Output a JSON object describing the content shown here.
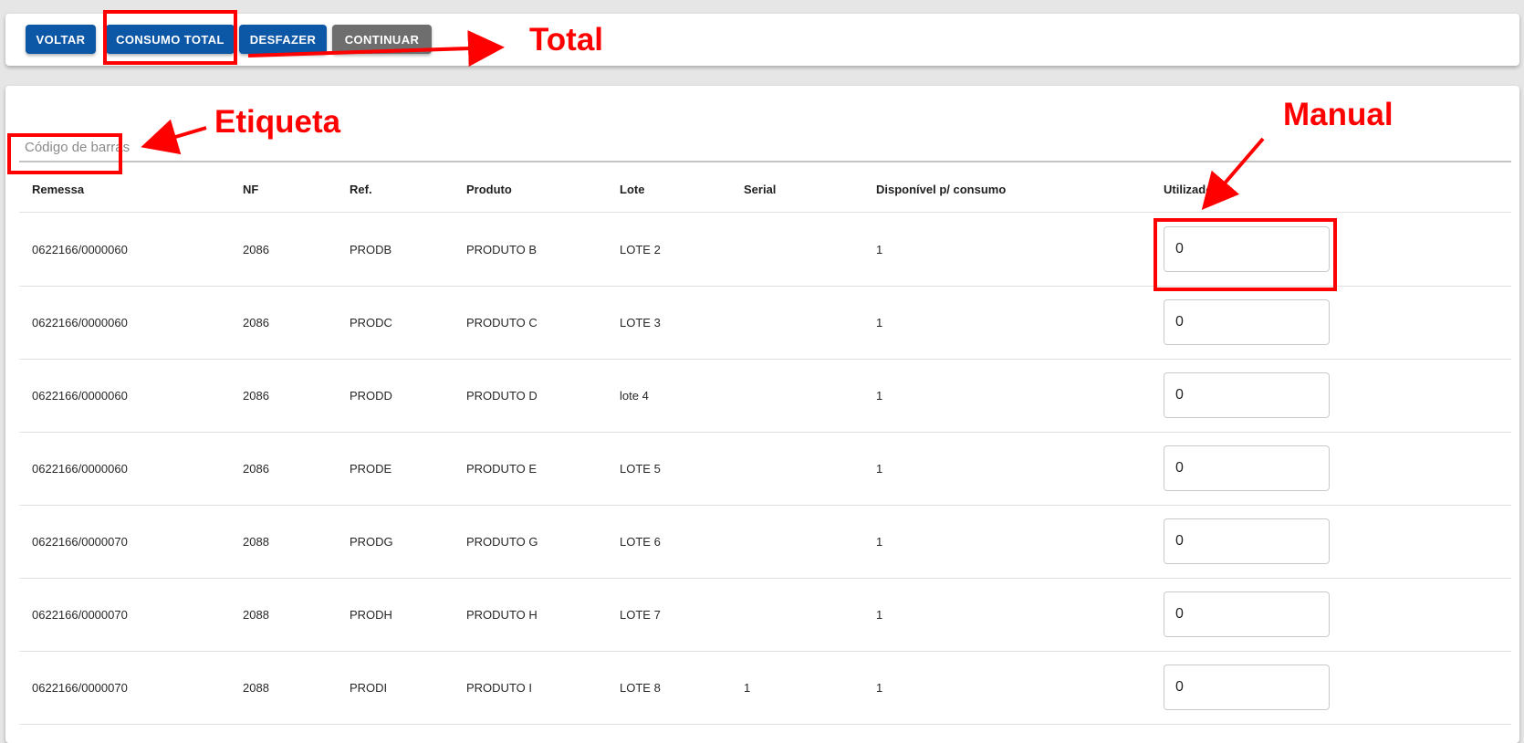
{
  "toolbar": {
    "voltar_label": "VOLTAR",
    "consumo_total_label": "CONSUMO TOTAL",
    "desfazer_label": "DESFAZER",
    "continuar_label": "CONTINUAR"
  },
  "barcode": {
    "placeholder": "Código de barras",
    "value": ""
  },
  "table": {
    "headers": {
      "remessa": "Remessa",
      "nf": "NF",
      "ref": "Ref.",
      "produto": "Produto",
      "lote": "Lote",
      "serial": "Serial",
      "disponivel": "Disponível p/ consumo",
      "utilizado": "Utilizado"
    },
    "rows": [
      {
        "remessa": "0622166/0000060",
        "nf": "2086",
        "ref": "PRODB",
        "produto": "PRODUTO B",
        "lote": "LOTE 2",
        "serial": "",
        "disponivel": "1",
        "utilizado": "0"
      },
      {
        "remessa": "0622166/0000060",
        "nf": "2086",
        "ref": "PRODC",
        "produto": "PRODUTO C",
        "lote": "LOTE 3",
        "serial": "",
        "disponivel": "1",
        "utilizado": "0"
      },
      {
        "remessa": "0622166/0000060",
        "nf": "2086",
        "ref": "PRODD",
        "produto": "PRODUTO D",
        "lote": "lote 4",
        "serial": "",
        "disponivel": "1",
        "utilizado": "0"
      },
      {
        "remessa": "0622166/0000060",
        "nf": "2086",
        "ref": "PRODE",
        "produto": "PRODUTO E",
        "lote": "LOTE 5",
        "serial": "",
        "disponivel": "1",
        "utilizado": "0"
      },
      {
        "remessa": "0622166/0000070",
        "nf": "2088",
        "ref": "PRODG",
        "produto": "PRODUTO G",
        "lote": "LOTE 6",
        "serial": "",
        "disponivel": "1",
        "utilizado": "0"
      },
      {
        "remessa": "0622166/0000070",
        "nf": "2088",
        "ref": "PRODH",
        "produto": "PRODUTO H",
        "lote": "LOTE 7",
        "serial": "",
        "disponivel": "1",
        "utilizado": "0"
      },
      {
        "remessa": "0622166/0000070",
        "nf": "2088",
        "ref": "PRODI",
        "produto": "PRODUTO I",
        "lote": "LOTE 8",
        "serial": "1",
        "disponivel": "1",
        "utilizado": "0"
      }
    ]
  },
  "annotations": {
    "total": "Total",
    "etiqueta": "Etiqueta",
    "manual": "Manual",
    "color": "#ff0000"
  },
  "colors": {
    "primary_button": "#0d57a7",
    "disabled_button": "#6e6e6e"
  }
}
